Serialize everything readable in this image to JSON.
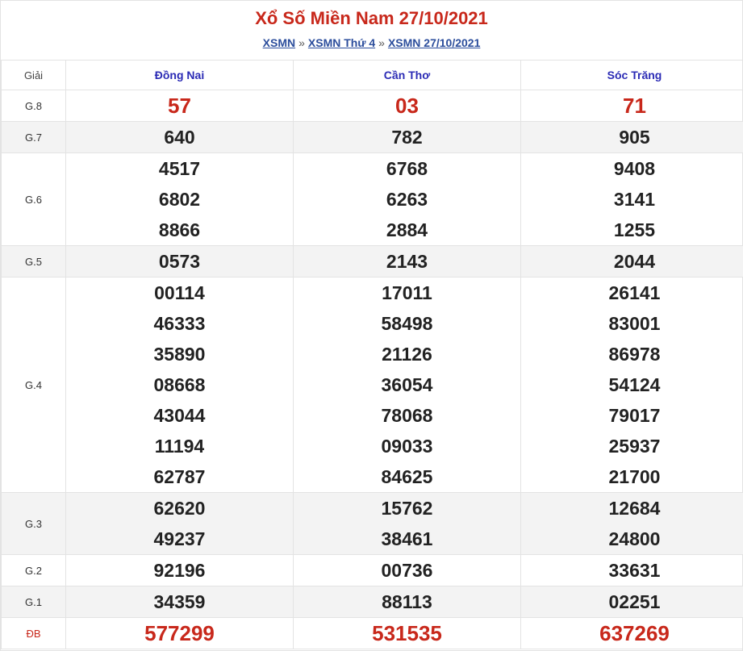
{
  "header": {
    "title": "Xổ Số Miền Nam 27/10/2021",
    "breadcrumb": [
      {
        "label": "XSMN"
      },
      {
        "label": "XSMN Thứ 4"
      },
      {
        "label": "XSMN 27/10/2021"
      }
    ],
    "separator": "»"
  },
  "table": {
    "giai_header": "Giải",
    "provinces": [
      "Đồng Nai",
      "Cần Thơ",
      "Sóc Trăng"
    ],
    "rows": [
      {
        "label": "G.8",
        "values": [
          [
            "57"
          ],
          [
            "03"
          ],
          [
            "71"
          ]
        ]
      },
      {
        "label": "G.7",
        "values": [
          [
            "640"
          ],
          [
            "782"
          ],
          [
            "905"
          ]
        ]
      },
      {
        "label": "G.6",
        "values": [
          [
            "4517",
            "6802",
            "8866"
          ],
          [
            "6768",
            "6263",
            "2884"
          ],
          [
            "9408",
            "3141",
            "1255"
          ]
        ]
      },
      {
        "label": "G.5",
        "values": [
          [
            "0573"
          ],
          [
            "2143"
          ],
          [
            "2044"
          ]
        ]
      },
      {
        "label": "G.4",
        "values": [
          [
            "00114",
            "46333",
            "35890",
            "08668",
            "43044",
            "11194",
            "62787"
          ],
          [
            "17011",
            "58498",
            "21126",
            "36054",
            "78068",
            "09033",
            "84625"
          ],
          [
            "26141",
            "83001",
            "86978",
            "54124",
            "79017",
            "25937",
            "21700"
          ]
        ]
      },
      {
        "label": "G.3",
        "values": [
          [
            "62620",
            "49237"
          ],
          [
            "15762",
            "38461"
          ],
          [
            "12684",
            "24800"
          ]
        ]
      },
      {
        "label": "G.2",
        "values": [
          [
            "92196"
          ],
          [
            "00736"
          ],
          [
            "33631"
          ]
        ]
      },
      {
        "label": "G.1",
        "values": [
          [
            "34359"
          ],
          [
            "88113"
          ],
          [
            "02251"
          ]
        ]
      },
      {
        "label": "ĐB",
        "values": [
          [
            "577299"
          ],
          [
            "531535"
          ],
          [
            "637269"
          ]
        ]
      }
    ]
  },
  "colors": {
    "title_red": "#c8281b",
    "province_blue": "#2b2bb5",
    "link_blue": "#2b4d9c",
    "alt_row": "#f3f3f3"
  }
}
